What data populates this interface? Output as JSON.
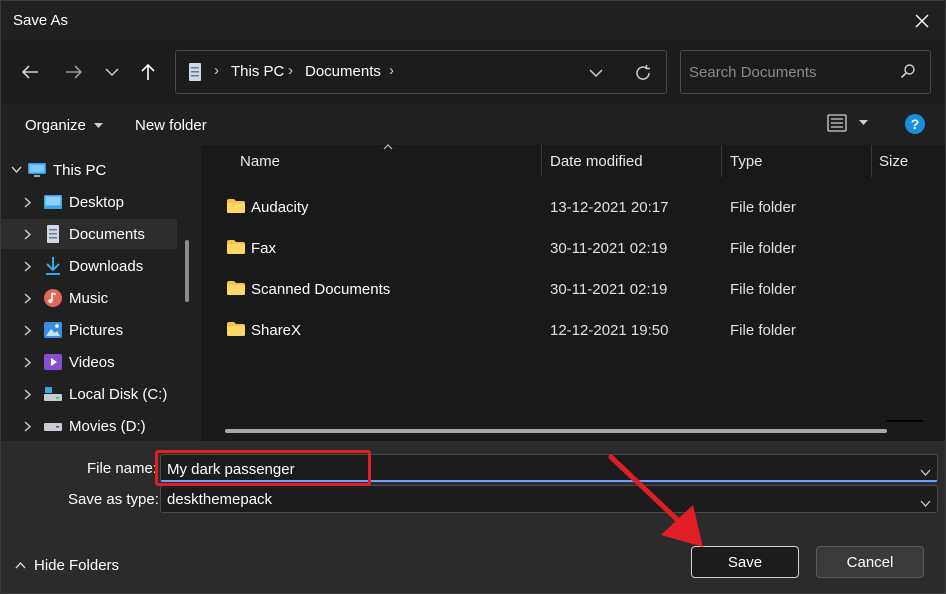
{
  "window": {
    "title": "Save As"
  },
  "navigation": {
    "breadcrumb": [
      "This PC",
      "Documents"
    ],
    "search_placeholder": "Search Documents"
  },
  "command_bar": {
    "organize_label": "Organize",
    "new_folder_label": "New folder",
    "help_label": "?"
  },
  "sidebar": {
    "items": [
      {
        "label": "This PC",
        "icon": "computer-icon",
        "selected": false
      },
      {
        "label": "Desktop",
        "icon": "desktop-icon",
        "selected": false
      },
      {
        "label": "Documents",
        "icon": "documents-icon",
        "selected": true
      },
      {
        "label": "Downloads",
        "icon": "download-icon",
        "selected": false
      },
      {
        "label": "Music",
        "icon": "music-icon",
        "selected": false
      },
      {
        "label": "Pictures",
        "icon": "pictures-icon",
        "selected": false
      },
      {
        "label": "Videos",
        "icon": "videos-icon",
        "selected": false
      },
      {
        "label": "Local Disk (C:)",
        "icon": "drive-icon",
        "selected": false
      },
      {
        "label": "Movies (D:)",
        "icon": "drive-icon",
        "selected": false
      }
    ]
  },
  "file_list": {
    "columns": [
      "Name",
      "Date modified",
      "Type",
      "Size"
    ],
    "rows": [
      {
        "name": "Audacity",
        "date": "13-12-2021 20:17",
        "type": "File folder",
        "icon": "folder-icon"
      },
      {
        "name": "Fax",
        "date": "30-11-2021 02:19",
        "type": "File folder",
        "icon": "folder-icon"
      },
      {
        "name": "Scanned Documents",
        "date": "30-11-2021 02:19",
        "type": "File folder",
        "icon": "folder-icon"
      },
      {
        "name": "ShareX",
        "date": "12-12-2021 19:50",
        "type": "File folder",
        "icon": "folder-icon"
      }
    ]
  },
  "form": {
    "file_name_label": "File name:",
    "file_name_value": "My dark passenger",
    "save_type_label": "Save as type:",
    "save_type_value": "deskthemepack"
  },
  "footer": {
    "hide_folders_label": "Hide Folders",
    "save_label": "Save",
    "cancel_label": "Cancel"
  },
  "colors": {
    "accent": "#1a8fe0",
    "folder": "#f6c344",
    "annotation_red": "#e01e26"
  }
}
